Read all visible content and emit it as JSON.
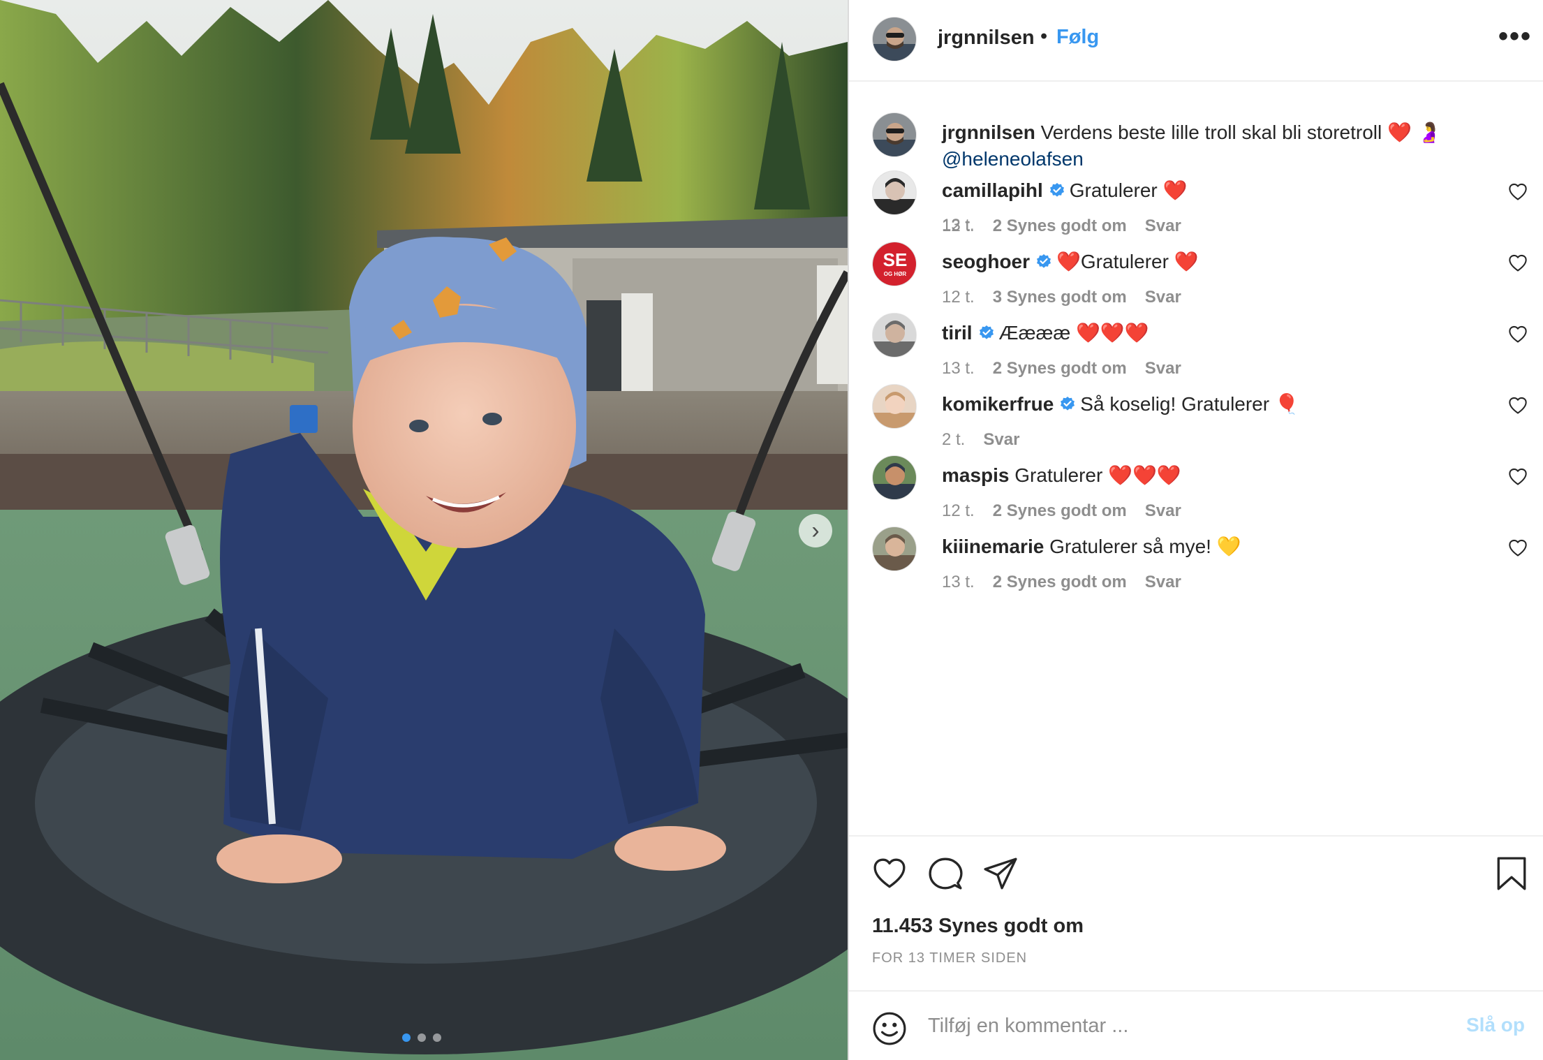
{
  "post": {
    "author": "jrgnnilsen",
    "separator": "•",
    "follow_label": "Følg",
    "more_label": "•••",
    "caption": {
      "user": "jrgnnilsen",
      "text": "Verdens beste lille troll skal bli storetroll",
      "emoji": "❤️ 🤰",
      "mention": "@heleneolafsen",
      "time": "13 t."
    },
    "likes_text": "11.453 Synes godt om",
    "timestamp": "FOR 13 TIMER SIDEN",
    "carousel": {
      "slides": 3,
      "active": 1
    }
  },
  "comments": [
    {
      "user": "camillapihl",
      "verified": true,
      "text": "Gratulerer",
      "emoji": "❤️",
      "time": "12 t.",
      "likes": "2 Synes godt om",
      "reply": "Svar"
    },
    {
      "user": "seoghoer",
      "verified": true,
      "text": "Gratulerer",
      "emoji_before": "❤️",
      "emoji": "❤️",
      "time": "12 t.",
      "likes": "3 Synes godt om",
      "reply": "Svar"
    },
    {
      "user": "tiril",
      "verified": true,
      "text": "Ææææ",
      "emoji": "❤️❤️❤️",
      "time": "13 t.",
      "likes": "2 Synes godt om",
      "reply": "Svar"
    },
    {
      "user": "komikerfrue",
      "verified": true,
      "text": "Så koselig! Gratulerer",
      "emoji": "🎈",
      "time": "2 t.",
      "likes": "",
      "reply": "Svar"
    },
    {
      "user": "maspis",
      "verified": false,
      "text": "Gratulerer",
      "emoji": "❤️❤️❤️",
      "time": "12 t.",
      "likes": "2 Synes godt om",
      "reply": "Svar"
    },
    {
      "user": "kiiinemarie",
      "verified": false,
      "text": "Gratulerer så mye!",
      "emoji": "💛",
      "time": "13 t.",
      "likes": "2 Synes godt om",
      "reply": "Svar"
    }
  ],
  "add_comment": {
    "placeholder": "Tilføj en kommentar ...",
    "post_label": "Slå op"
  },
  "seoghoer_avatar_text": {
    "top": "SE",
    "bottom": "OG HØR"
  },
  "colors": {
    "accent": "#3897f0",
    "text": "#262626",
    "muted": "#8e8e8e",
    "mention": "#00376b",
    "heart": "#ed4956",
    "post_disabled": "#b2dffc"
  }
}
